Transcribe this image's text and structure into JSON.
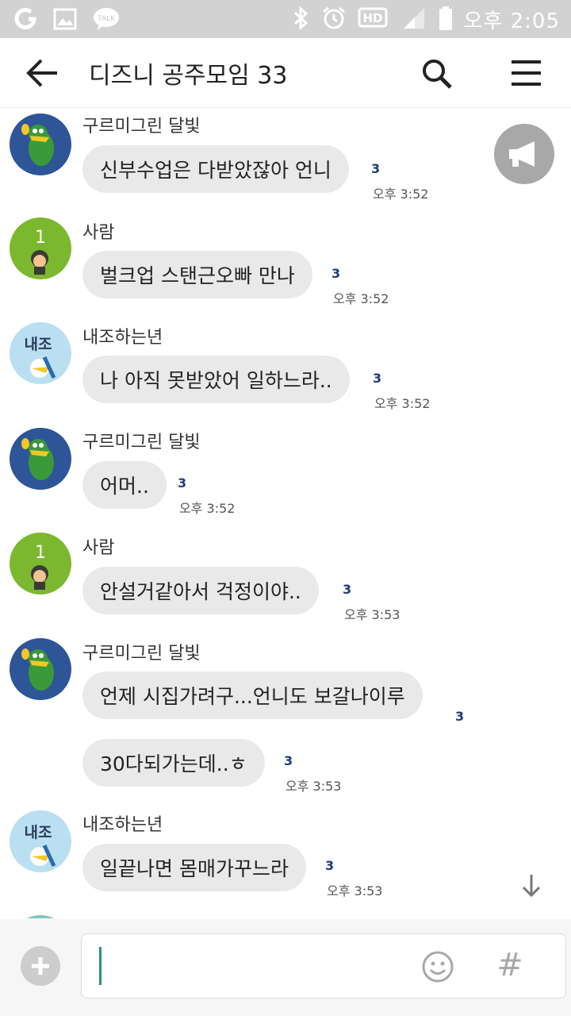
{
  "status_bar": {
    "left_icons": [
      "olleh-icon",
      "gallery-icon",
      "kakaotalk-icon"
    ],
    "talk_badge": "TALK",
    "right_icons": [
      "bluetooth-icon",
      "alarm-icon",
      "hd-icon",
      "signal-icon",
      "battery-icon"
    ],
    "hd_label": "HD",
    "time": "오후 2:05"
  },
  "header": {
    "title": "디즈니 공주모임 33"
  },
  "messages": [
    {
      "sender": "구르미그린 달빛",
      "avatar": "green-crocodile",
      "text": "신부수업은 다받았잖아 언니",
      "unread": "3",
      "time": "오후 3:52"
    },
    {
      "sender": "사람",
      "avatar": "number-1-kakao",
      "avatar_label": "1",
      "text": "벌크업 스탠근오빠 만나",
      "unread": "3",
      "time": "오후 3:52"
    },
    {
      "sender": "내조하는년",
      "avatar": "naejo-duck",
      "avatar_label": "내조",
      "text": "나 아직 못받았어 일하느라..",
      "unread": "3",
      "time": "오후 3:52"
    },
    {
      "sender": "구르미그린 달빛",
      "avatar": "green-crocodile",
      "text": "어머..",
      "unread": "3",
      "time": "오후 3:52"
    },
    {
      "sender": "사람",
      "avatar": "number-1-kakao",
      "avatar_label": "1",
      "text": "안설거같아서 걱정이야..",
      "unread": "3",
      "time": "오후 3:53"
    },
    {
      "sender": "구르미그린 달빛",
      "avatar": "green-crocodile",
      "text": "언제 시집가려구...언니도 보갈나이루",
      "unread": "3",
      "time": ""
    },
    {
      "sender": "",
      "avatar": "",
      "text": "30다되가는데..ㅎ",
      "unread": "3",
      "time": "오후 3:53"
    },
    {
      "sender": "내조하는년",
      "avatar": "naejo-duck",
      "avatar_label": "내조",
      "text": "일끝나면 몸매가꾸느라",
      "unread": "3",
      "time": "오후 3:53"
    }
  ],
  "input": {
    "value": "",
    "plus_icon": "plus-icon",
    "emoji_icon": "emoji-icon",
    "hash_label": "#"
  },
  "colors": {
    "status_bar": "#d2d2d2",
    "bubble": "#e9e9e9",
    "unread": "#1d3b7a",
    "cursor": "#2a8f84",
    "avatar_green": "#7cb82f",
    "avatar_blue": "#2e5597",
    "avatar_light": "#b9dff0"
  }
}
